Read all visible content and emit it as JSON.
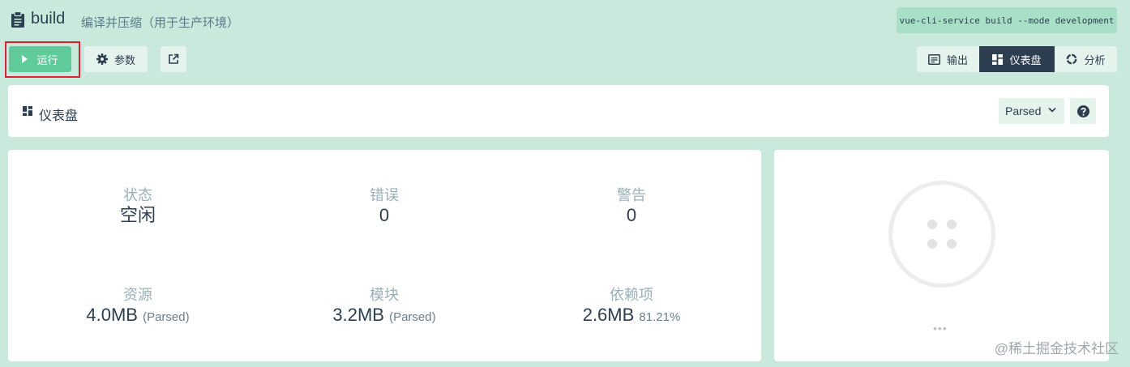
{
  "header": {
    "task_name": "build",
    "task_description": "编译并压缩（用于生产环境）",
    "command": "vue-cli-service build --mode development"
  },
  "toolbar": {
    "run_label": "运行",
    "params_label": "参数",
    "open_icon": "external-link-icon"
  },
  "view_tabs": [
    {
      "label": "输出",
      "icon": "terminal-icon"
    },
    {
      "label": "仪表盘",
      "icon": "dashboard-icon",
      "active": true
    },
    {
      "label": "分析",
      "icon": "donut-chart-icon"
    }
  ],
  "dashboard": {
    "title": "仪表盘",
    "size_mode": "Parsed",
    "help_icon": "question-icon"
  },
  "stats": {
    "status": {
      "label": "状态",
      "value": "空闲"
    },
    "errors": {
      "label": "错误",
      "value": "0"
    },
    "warnings": {
      "label": "警告",
      "value": "0"
    },
    "assets": {
      "label": "资源",
      "value": "4.0MB",
      "sub": "(Parsed)"
    },
    "modules": {
      "label": "模块",
      "value": "3.2MB",
      "sub": "(Parsed)"
    },
    "dependencies": {
      "label": "依赖项",
      "value": "2.6MB",
      "sub": "81.21%"
    }
  },
  "graph": {
    "more": "•••"
  },
  "watermark": "@稀土掘金技术社区",
  "colors": {
    "background": "#c9e9dd",
    "accent": "#5fcb9b",
    "dark": "#2c3e50",
    "highlight": "#e0232b"
  }
}
